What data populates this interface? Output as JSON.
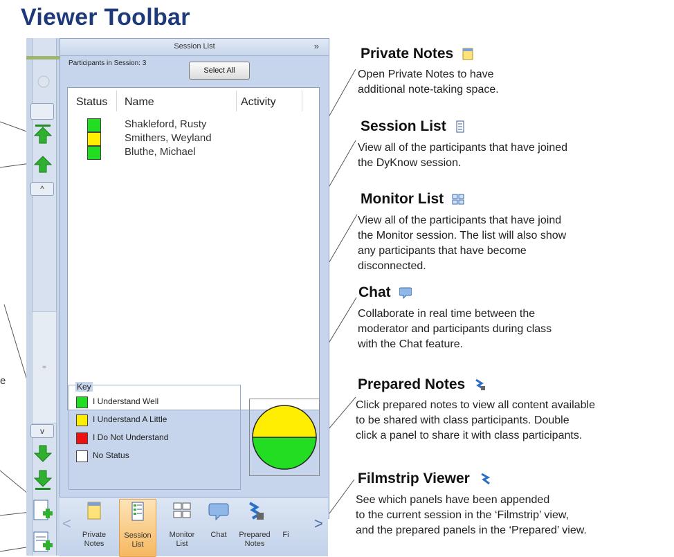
{
  "page_title": "Viewer Toolbar",
  "left_fragment_text": "e",
  "session_list_panel": {
    "header_title": "Session List",
    "expand_chevron": "»",
    "participants_label": "Participants in Session: 3",
    "select_all_label": "Select All",
    "columns": [
      "Status",
      "Name",
      "Activity"
    ],
    "participants": [
      {
        "name": "Shakleford, Rusty",
        "status_color": "#22dd22"
      },
      {
        "name": "Smithers, Weyland",
        "status_color": "#ffee00"
      },
      {
        "name": "Bluthe, Michael",
        "status_color": "#22dd22"
      }
    ],
    "key_label": "Key",
    "key_items": [
      {
        "label": "I Understand Well",
        "color": "#22dd22"
      },
      {
        "label": "I Understand A Little",
        "color": "#ffee00"
      },
      {
        "label": "I Do Not Understand",
        "color": "#ee1111"
      },
      {
        "label": "No Status",
        "color": "#ffffff"
      }
    ],
    "pie": {
      "yellow_fraction": 0.5,
      "green_fraction": 0.5
    }
  },
  "nav_bar": {
    "items": [
      {
        "line1": "Private",
        "line2": "Notes",
        "icon": "private-notes-icon",
        "selected": false
      },
      {
        "line1": "Session",
        "line2": "List",
        "icon": "session-list-icon",
        "selected": true
      },
      {
        "line1": "Monitor",
        "line2": "List",
        "icon": "monitor-list-icon",
        "selected": false
      },
      {
        "line1": "Chat",
        "line2": "",
        "icon": "chat-icon",
        "selected": false
      },
      {
        "line1": "Prepared",
        "line2": "Notes",
        "icon": "prepared-notes-icon",
        "selected": false
      },
      {
        "line1": "Fi",
        "line2": "",
        "icon": "filmstrip-icon",
        "selected": false
      }
    ],
    "prev_arrow": "<",
    "next_arrow": ">"
  },
  "callouts": [
    {
      "title": "Private Notes",
      "icon": "private-notes-icon",
      "text": [
        "Open Private Notes to have",
        "additional note-taking space."
      ]
    },
    {
      "title": "Session List",
      "icon": "session-list-icon",
      "text": [
        "View all of the participants that have joined",
        "the DyKnow session."
      ]
    },
    {
      "title": "Monitor List",
      "icon": "monitor-list-icon",
      "text": [
        "View all of the participants that have joind",
        "the Monitor session. The list will also show",
        "any participants that have become",
        "disconnected."
      ]
    },
    {
      "title": "Chat",
      "icon": "chat-icon",
      "text": [
        "Collaborate in real time between the",
        "moderator and participants during class",
        "with the Chat feature."
      ]
    },
    {
      "title": "Prepared Notes",
      "icon": "prepared-notes-icon",
      "text": [
        "Click prepared notes to view all content available",
        "to be shared with class participants.  Double",
        "click a panel to share it with class participants."
      ]
    },
    {
      "title": "Filmstrip Viewer",
      "icon": "filmstrip-icon",
      "text": [
        "See which panels have been appended",
        "to the current session in the ‘Filmstrip’ view,",
        "and the prepared panels in the ‘Prepared’ view."
      ]
    }
  ],
  "colors": {
    "title_blue": "#1f3a7a",
    "panel_bg": "#c7d5ec",
    "selected_tab": "#f6b860"
  }
}
